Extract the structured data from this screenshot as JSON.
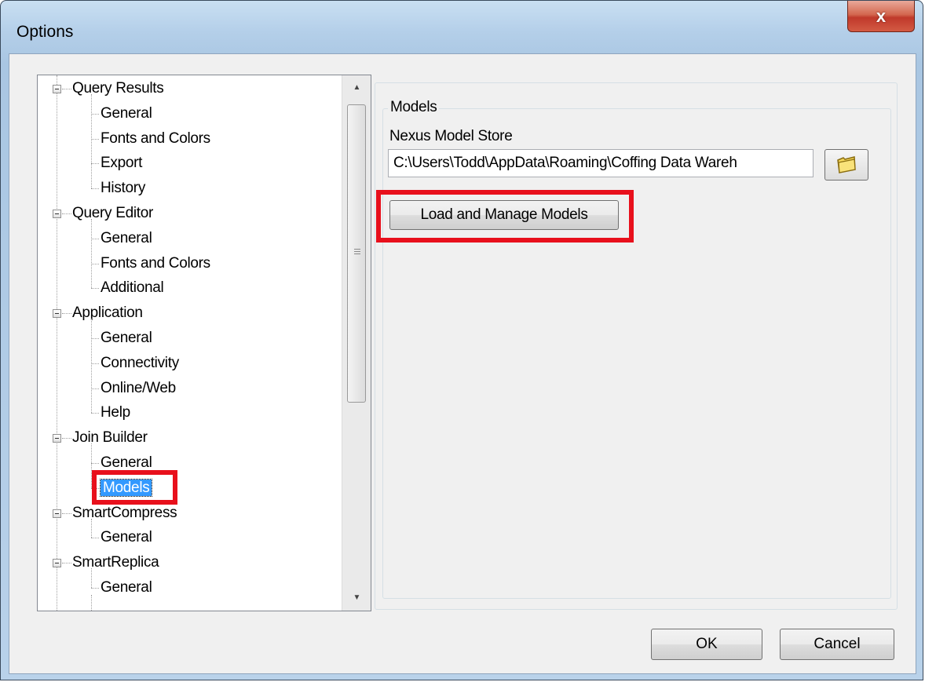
{
  "window": {
    "title": "Options",
    "close_label": "x"
  },
  "tree": {
    "groups": [
      {
        "label": "Query Results",
        "children": [
          "General",
          "Fonts and Colors",
          "Export",
          "History"
        ]
      },
      {
        "label": "Query Editor",
        "children": [
          "General",
          "Fonts and Colors",
          "Additional"
        ]
      },
      {
        "label": "Application",
        "children": [
          "General",
          "Connectivity",
          "Online/Web",
          "Help"
        ]
      },
      {
        "label": "Join Builder",
        "children": [
          "General",
          "Models"
        ]
      },
      {
        "label": "SmartCompress",
        "children": [
          "General"
        ]
      },
      {
        "label": "SmartReplica",
        "children": [
          "General"
        ]
      }
    ],
    "selected": "Models"
  },
  "models_panel": {
    "group_title": "Models",
    "store_label": "Nexus Model Store",
    "store_path": "C:\\Users\\Todd\\AppData\\Roaming\\Coffing Data Wareh",
    "load_button": "Load and Manage Models"
  },
  "footer": {
    "ok": "OK",
    "cancel": "Cancel"
  },
  "colors": {
    "highlight": "#e8101c",
    "selection": "#3399ff",
    "close": "#c0392b"
  }
}
